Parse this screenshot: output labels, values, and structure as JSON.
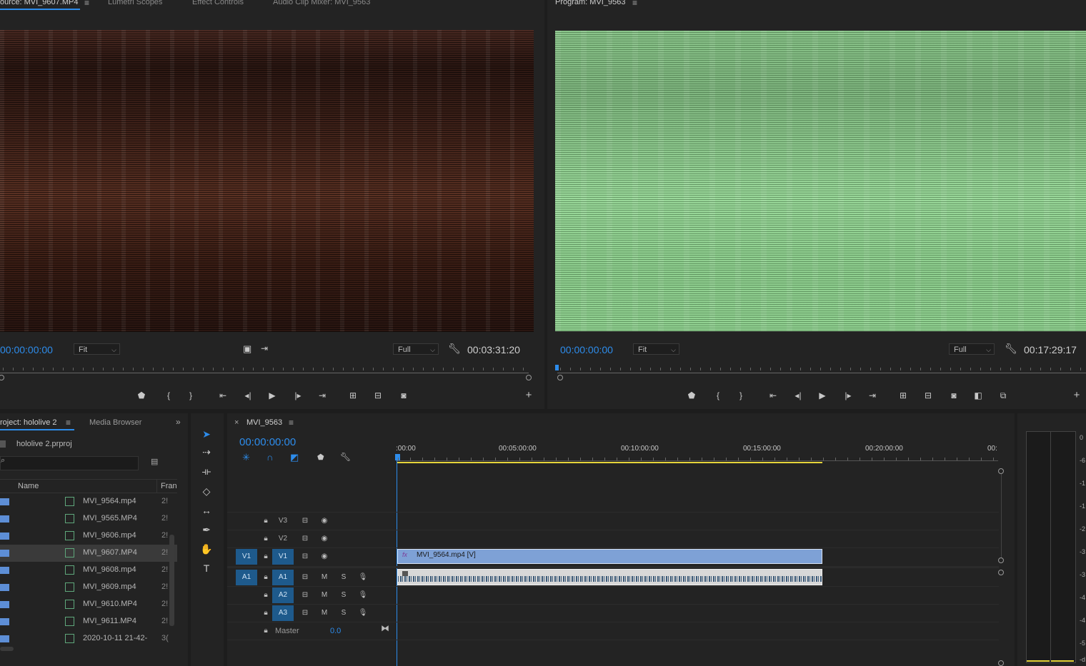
{
  "source_panel": {
    "tabs": [
      "ource: MVI_9607.MP4",
      "Lumetri Scopes",
      "Effect Controls",
      "Audio Clip Mixer: MVI_9563"
    ],
    "timecode": "00:00:00:00",
    "fit": "Fit",
    "resolution": "Full",
    "duration": "00:03:31:20"
  },
  "program_panel": {
    "title": "Program: MVI_9563",
    "timecode": "00:00:00:00",
    "fit": "Fit",
    "resolution": "Full",
    "duration": "00:17:29:17"
  },
  "project_panel": {
    "tabs": [
      "roject: hololive 2",
      "Media Browser"
    ],
    "file": "hololive 2.prproj",
    "columns": [
      "Name",
      "Fran"
    ],
    "items": [
      {
        "name": "MVI_9564.mp4",
        "fr": "2!"
      },
      {
        "name": "MVI_9565.MP4",
        "fr": "2!"
      },
      {
        "name": "MVI_9606.mp4",
        "fr": "2!"
      },
      {
        "name": "MVI_9607.MP4",
        "fr": "2!"
      },
      {
        "name": "MVI_9608.mp4",
        "fr": "2!"
      },
      {
        "name": "MVI_9609.mp4",
        "fr": "2!"
      },
      {
        "name": "MVI_9610.MP4",
        "fr": "2!"
      },
      {
        "name": "MVI_9611.MP4",
        "fr": "2!"
      },
      {
        "name": "2020-10-11 21-42-",
        "fr": "3("
      }
    ]
  },
  "timeline": {
    "sequence": "MVI_9563",
    "timecode": "00:00:00:00",
    "ruler_labels": [
      ":00:00",
      "00:05:00:00",
      "00:10:00:00",
      "00:15:00:00",
      "00:20:00:00",
      "00:"
    ],
    "tracks": {
      "v3": "V3",
      "v2": "V2",
      "v1": "V1",
      "v1_src": "V1",
      "a1": "A1",
      "a1_src": "A1",
      "a2": "A2",
      "a3": "A3"
    },
    "m": "M",
    "s": "S",
    "master_label": "Master",
    "master_value": "0.0",
    "video_clip": "MVI_9564.mp4 [V]",
    "fx": "fx"
  },
  "meter": {
    "scale": [
      "0",
      "-6",
      "-1",
      "-1",
      "-2",
      "-3",
      "-3",
      "-4",
      "-4",
      "-5",
      "-d"
    ]
  },
  "colors": {
    "accent": "#2d8ceb",
    "clip_video": "#7ea1d6",
    "work_area": "#e5d43a"
  }
}
